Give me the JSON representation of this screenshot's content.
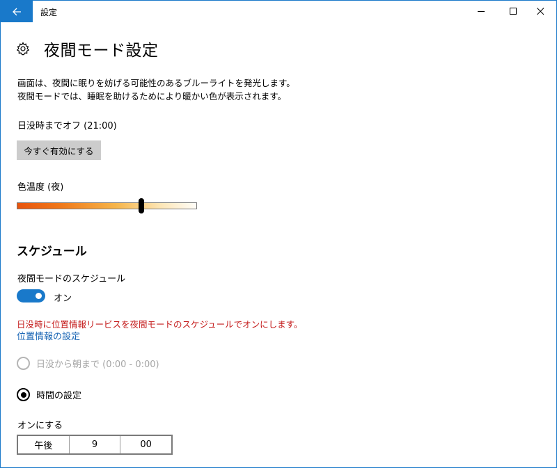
{
  "window": {
    "app_title": "設定",
    "accent_color": "#1979ca"
  },
  "icons": {
    "back": "back-arrow-icon",
    "minimize": "minimize-icon",
    "maximize": "maximize-icon",
    "close": "close-icon",
    "page": "gear-icon"
  },
  "header": {
    "title": "夜間モード設定"
  },
  "main": {
    "description": "画面は、夜間に眠りを妨げる可能性のあるブルーライトを発光します。夜間モードでは、睡眠を助けるためにより暖かい色が表示されます。",
    "status": "日没時までオフ (21:00)",
    "enable_button": "今すぐ有効にする",
    "color_temp": {
      "label": "色温度 (夜)",
      "value_fraction": 0.69
    }
  },
  "schedule": {
    "section_title": "スケジュール",
    "toggle_label": "夜間モードのスケジュール",
    "toggle_state_text": "オン",
    "toggle_on": true,
    "warning": "日没時に位置情報リービスを夜間モードのスケジュールでオンにします。",
    "warning_color": "#c41a1a",
    "location_link": "位置情報の設定",
    "options": [
      {
        "label": "日没から朝まで (0:00 - 0:00)",
        "selected": false,
        "disabled": true
      },
      {
        "label": "時間の設定",
        "selected": true,
        "disabled": false
      }
    ],
    "turn_on_label": "オンにする",
    "time": {
      "period": "午後",
      "hour": "9",
      "minute": "00"
    }
  }
}
